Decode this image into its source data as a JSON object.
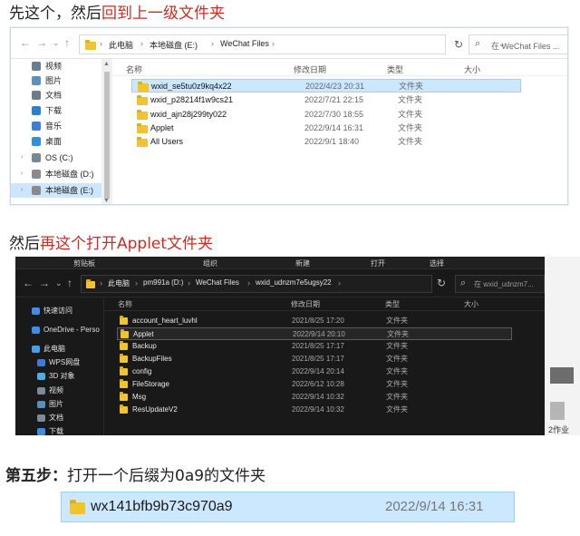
{
  "heading1": {
    "prefix": "先这个，然后",
    "highlight": "回到上一级文件夹"
  },
  "heading2": {
    "prefix": "然后",
    "highlight": "再这个打开Applet文件夹"
  },
  "heading3": {
    "step": "第五步：",
    "text": "打开一个后缀为0a9的文件夹"
  },
  "explorer_light": {
    "nav": {
      "back": "←",
      "forward": "→",
      "recent": "⌄",
      "up": "↑"
    },
    "breadcrumb": [
      "此电脑",
      "本地磁盘 (E:)",
      "WeChat Files"
    ],
    "separator": "›",
    "dropdown": "⌄",
    "refresh": "↻",
    "search_placeholder": "在 WeChat Files ...",
    "sidebar": [
      {
        "label": "视频",
        "icon": "video-icon",
        "color": "#6a7d8f"
      },
      {
        "label": "图片",
        "icon": "picture-icon",
        "color": "#5b8fbf"
      },
      {
        "label": "文档",
        "icon": "document-icon",
        "color": "#6e7c8a"
      },
      {
        "label": "下载",
        "icon": "download-icon",
        "color": "#2b7fd0"
      },
      {
        "label": "音乐",
        "icon": "music-icon",
        "color": "#3b7dd8"
      },
      {
        "label": "桌面",
        "icon": "desktop-icon",
        "color": "#2f8fe0"
      },
      {
        "label": "OS (C:)",
        "icon": "drive-icon",
        "color": "#7a8794"
      },
      {
        "label": "本地磁盘 (D:)",
        "icon": "drive-icon",
        "color": "#8a8a8a"
      },
      {
        "label": "本地磁盘 (E:)",
        "icon": "drive-icon",
        "color": "#8a8a8a",
        "selected": true
      }
    ],
    "columns": {
      "name": "名称",
      "date": "修改日期",
      "type": "类型",
      "size": "大小"
    },
    "rows": [
      {
        "name": "wxid_se5tu0z9kq4x22",
        "date": "2022/4/23 20:31",
        "type": "文件夹",
        "selected": true
      },
      {
        "name": "wxid_p28214f1w9cs21",
        "date": "2022/7/21 22:15",
        "type": "文件夹"
      },
      {
        "name": "wxid_ajn28j299ty022",
        "date": "2022/7/30 18:55",
        "type": "文件夹"
      },
      {
        "name": "Applet",
        "date": "2022/9/14 16:31",
        "type": "文件夹"
      },
      {
        "name": "All Users",
        "date": "2022/9/1 18:40",
        "type": "文件夹"
      }
    ]
  },
  "explorer_dark": {
    "ribbon": [
      "剪贴板",
      "组织",
      "新建",
      "打开",
      "选择"
    ],
    "nav": {
      "back": "←",
      "forward": "→",
      "recent": "⌄",
      "up": "↑"
    },
    "breadcrumb": [
      "此电脑",
      "pm991a (D:)",
      "WeChat Files",
      "wxid_udnzm7e5ugsy22"
    ],
    "separator": "›",
    "refresh": "↻",
    "search_placeholder": "在 wxid_udnzm7...",
    "sidebar": [
      {
        "label": "快速访问",
        "icon": "star-icon",
        "color": "#3d8ee8"
      },
      {
        "label": "OneDrive - Perso",
        "icon": "cloud-icon",
        "color": "#3d8ee8"
      },
      {
        "label": "此电脑",
        "icon": "computer-icon",
        "color": "#4a9be8"
      },
      {
        "label": "WPS网盘",
        "icon": "cloud-drive-icon",
        "color": "#3b7dd8"
      },
      {
        "label": "3D 对象",
        "icon": "cube-icon",
        "color": "#4ab0e0"
      },
      {
        "label": "视频",
        "icon": "video-icon",
        "color": "#7d8b99"
      },
      {
        "label": "图片",
        "icon": "picture-icon",
        "color": "#5b8fbf"
      },
      {
        "label": "文档",
        "icon": "document-icon",
        "color": "#7d8b99"
      },
      {
        "label": "下载",
        "icon": "download-icon",
        "color": "#3b8fe0"
      }
    ],
    "columns": {
      "name": "名称",
      "date": "修改日期",
      "type": "类型",
      "size": "大小"
    },
    "rows": [
      {
        "name": "account_heart_luvhl",
        "date": "2021/8/25 17:20",
        "type": "文件夹"
      },
      {
        "name": "Applet",
        "date": "2022/9/14 20:10",
        "type": "文件夹",
        "selected": true
      },
      {
        "name": "Backup",
        "date": "2021/8/25 17:17",
        "type": "文件夹"
      },
      {
        "name": "BackupFiles",
        "date": "2021/8/25 17:17",
        "type": "文件夹"
      },
      {
        "name": "config",
        "date": "2022/9/14 20:14",
        "type": "文件夹"
      },
      {
        "name": "FileStorage",
        "date": "2022/6/12 10:28",
        "type": "文件夹"
      },
      {
        "name": "Msg",
        "date": "2022/9/14 10:32",
        "type": "文件夹"
      },
      {
        "name": "ResUpdateV2",
        "date": "2022/9/14 10:32",
        "type": "文件夹"
      }
    ]
  },
  "background_strip": {
    "text": "2作业"
  },
  "target_folder": {
    "name": "wx141bfb9b73c970a9",
    "date": "2022/9/14 16:31"
  }
}
